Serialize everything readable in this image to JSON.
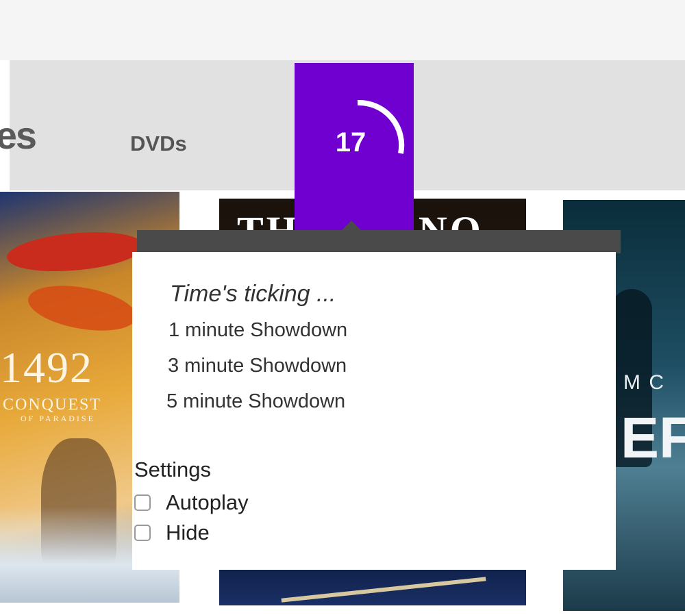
{
  "nav": {
    "partial_label": "es",
    "dvds_label": "DVDs"
  },
  "timer": {
    "count": "17",
    "accent_color": "#6f00cf",
    "arc_icon": "countdown-ring-icon"
  },
  "posters": [
    {
      "title": "1492",
      "subtitle": "CONQUEST",
      "tagline": "OF PARADISE"
    },
    {
      "title": "THE PIANO"
    },
    {
      "title": "M C",
      "big_text": "EF"
    }
  ],
  "popup": {
    "heading": "Time's ticking ...",
    "options": [
      "1 minute Showdown",
      "3 minute Showdown",
      "5 minute Showdown"
    ],
    "settings_label": "Settings",
    "checkboxes": [
      {
        "label": "Autoplay",
        "checked": false
      },
      {
        "label": "Hide",
        "checked": false
      }
    ]
  }
}
